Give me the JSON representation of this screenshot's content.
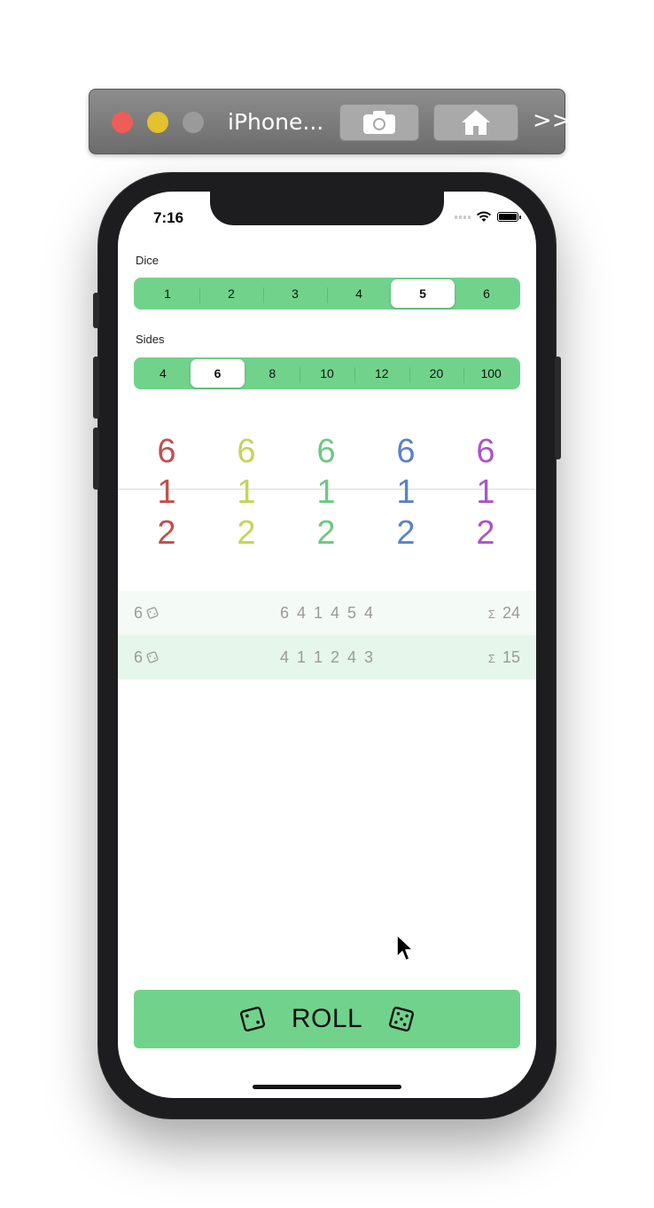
{
  "simulator": {
    "title": "iPhone...",
    "screenshot_icon": "camera-icon",
    "home_icon": "home-icon",
    "more_label": ">>"
  },
  "status_bar": {
    "time": "7:16"
  },
  "dice_selector": {
    "label": "Dice",
    "options": [
      "1",
      "2",
      "3",
      "4",
      "5",
      "6"
    ],
    "selected": "5"
  },
  "sides_selector": {
    "label": "Sides",
    "options": [
      "4",
      "6",
      "8",
      "10",
      "12",
      "20",
      "100"
    ],
    "selected": "6"
  },
  "picker": {
    "columns": [
      {
        "above": "6",
        "current": "1",
        "below": "2",
        "color": "#c0504d"
      },
      {
        "above": "6",
        "current": "1",
        "below": "2",
        "color": "#c4d45a"
      },
      {
        "above": "6",
        "current": "1",
        "below": "2",
        "color": "#6cc982"
      },
      {
        "above": "6",
        "current": "1",
        "below": "2",
        "color": "#5a82c8"
      },
      {
        "above": "6",
        "current": "1",
        "below": "2",
        "color": "#a955c7"
      }
    ]
  },
  "history": [
    {
      "count": "6",
      "values": "6 4 1 4 5 4",
      "sum_symbol": "Σ",
      "sum": "24",
      "bg": "#f4faf5"
    },
    {
      "count": "6",
      "values": "4 1 1 2 4 3",
      "sum_symbol": "Σ",
      "sum": "15",
      "bg": "#e6f6ea"
    }
  ],
  "roll_button": {
    "label": "ROLL"
  },
  "colors": {
    "accent": "#71d38b"
  }
}
